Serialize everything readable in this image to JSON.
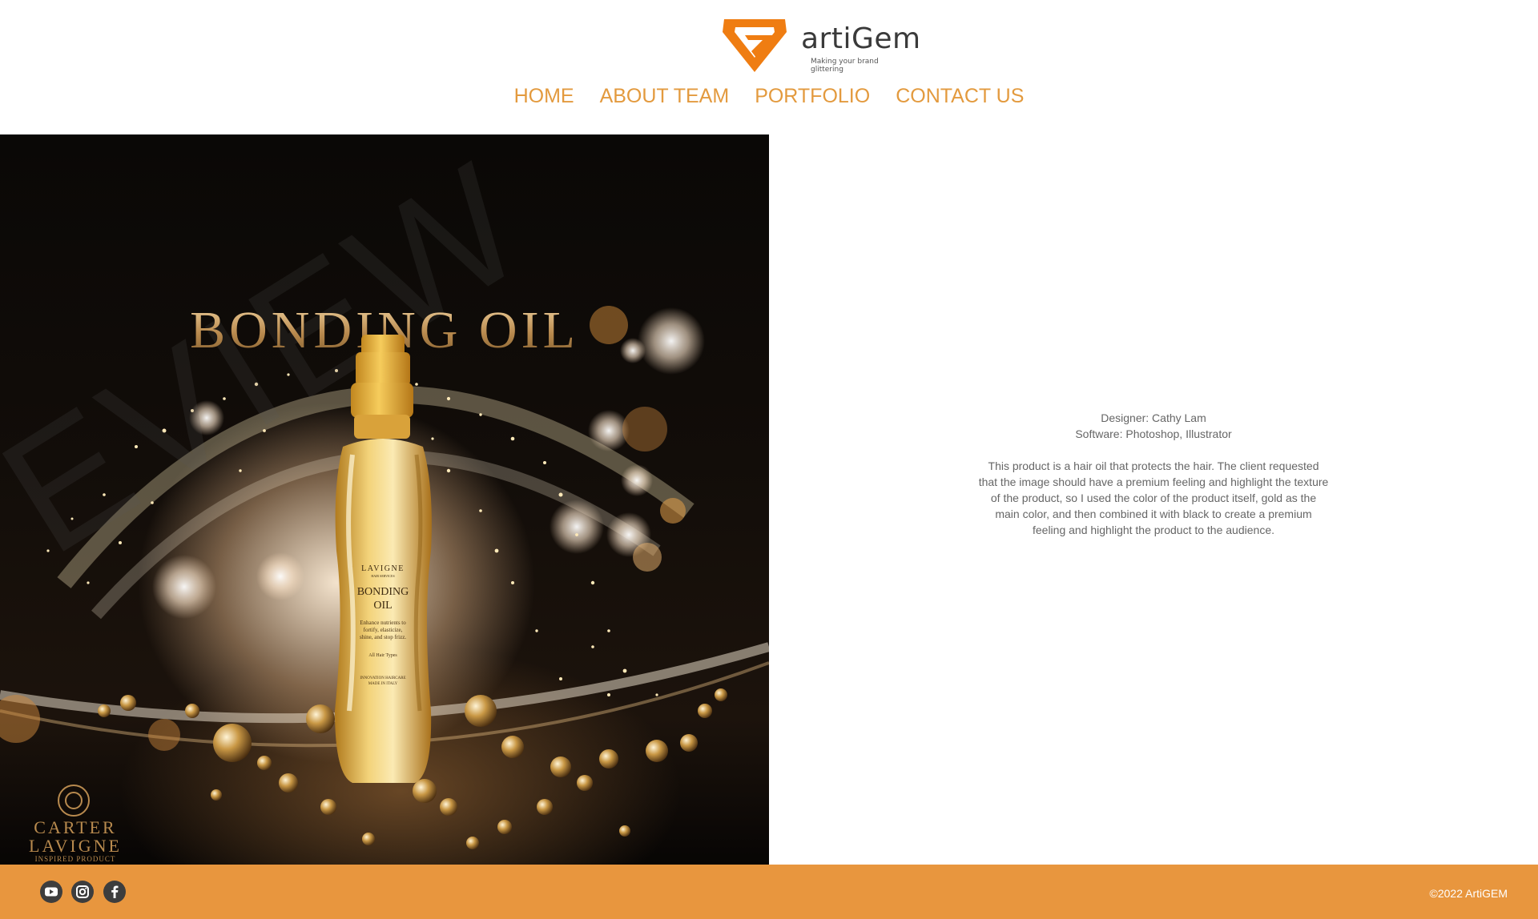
{
  "logo": {
    "name": "artiGem",
    "tagline": "Making your brand glittering"
  },
  "nav": [
    "HOME",
    "ABOUT TEAM",
    "PORTFOLIO",
    "CONTACT US"
  ],
  "hero": {
    "title": "BONDING OIL",
    "bottle_label": {
      "brand": "LAVIGNE",
      "sub": "HAIR SERVICES",
      "product_line1": "BONDING",
      "product_line2": "OIL",
      "desc_line1": "Enhance nutrients to",
      "desc_line2": "fortify, elasticize,",
      "desc_line3": "shine, and stop frizz.",
      "types": "All Hair Types",
      "footer_line1": "INNOVATION HAIRCARE",
      "footer_line2": "MADE IN ITALY"
    },
    "watermark": "EVIEW",
    "brand_mark": {
      "line1": "CARTER",
      "line2": "LAVIGNE",
      "line3": "INSPIRED PRODUCT"
    }
  },
  "details": {
    "designer": "Designer: Cathy Lam",
    "software": "Software: Photoshop, Illustrator",
    "description": "This product is a hair oil that protects the hair. The client requested that the image should have a premium feeling and highlight the texture of the product, so I used the color of the product itself, gold as the main color, and then combined it with black to create a premium feeling and highlight the product to the audience."
  },
  "footer": {
    "social": [
      "youtube-icon",
      "instagram-icon",
      "facebook-icon"
    ],
    "copyright": "©2022 ArtiGEM"
  },
  "colors": {
    "accent": "#e8963e",
    "nav_text": "#e39a3e",
    "logo_orange": "#ef7d12"
  }
}
